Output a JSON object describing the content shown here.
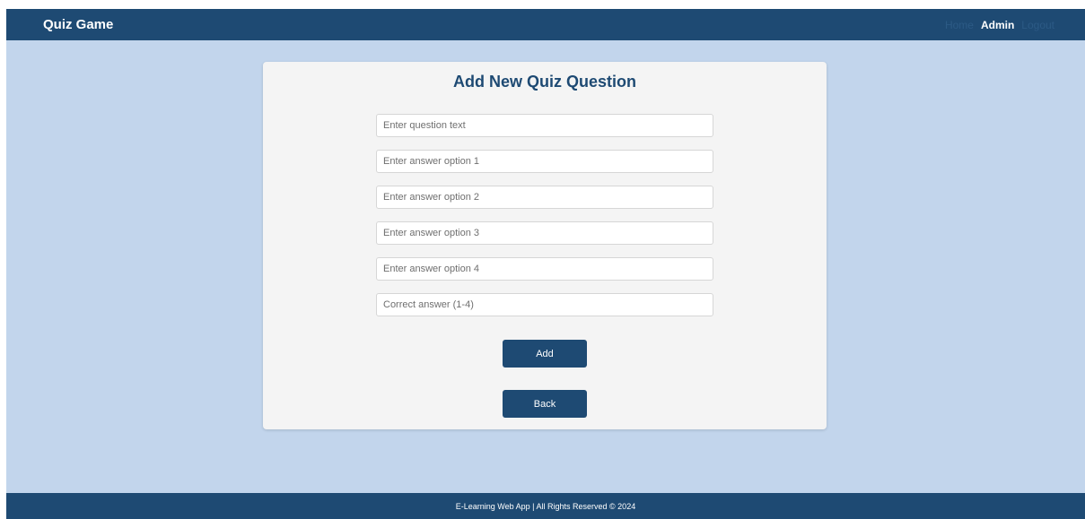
{
  "navbar": {
    "brand": "Quiz Game",
    "links": [
      {
        "label": "Home"
      },
      {
        "label": "Admin"
      },
      {
        "label": "Logout"
      }
    ]
  },
  "form": {
    "title": "Add New Quiz Question",
    "fields": [
      {
        "placeholder": "Enter question text",
        "value": ""
      },
      {
        "placeholder": "Enter answer option 1",
        "value": ""
      },
      {
        "placeholder": "Enter answer option 2",
        "value": ""
      },
      {
        "placeholder": "Enter answer option 3",
        "value": ""
      },
      {
        "placeholder": "Enter answer option 4",
        "value": ""
      },
      {
        "placeholder": "Correct answer (1-4)",
        "value": ""
      }
    ],
    "add_label": "Add",
    "back_label": "Back"
  },
  "footer": {
    "text": "E-Learning Web App | All Rights Reserved © 2024"
  },
  "colors": {
    "primary": "#1e4a73",
    "background": "#c2d5ec",
    "card": "#f4f4f4"
  }
}
